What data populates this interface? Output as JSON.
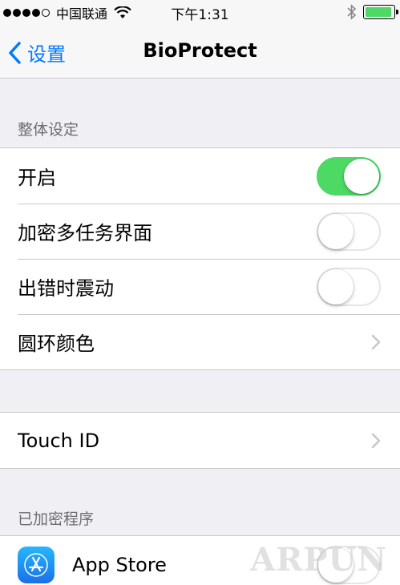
{
  "status_bar": {
    "carrier": "中国联通",
    "time": "下午1:31",
    "signal_bars_filled": 4,
    "signal_bars_total": 5,
    "battery_level": 0.95,
    "icons": [
      "wifi-icon",
      "bluetooth-icon",
      "battery-icon"
    ]
  },
  "nav": {
    "back_label": "设置",
    "title": "BioProtect"
  },
  "general": {
    "header": "整体设定",
    "rows": [
      {
        "label": "开启",
        "control": "toggle",
        "on": true
      },
      {
        "label": "加密多任务界面",
        "control": "toggle",
        "on": false
      },
      {
        "label": "出错时震动",
        "control": "toggle",
        "on": false
      },
      {
        "label": "圆环颜色",
        "control": "chevron"
      }
    ]
  },
  "touch_id": {
    "label": "Touch ID"
  },
  "encrypted_apps": {
    "header": "已加密程序",
    "rows": [
      {
        "label": "App Store",
        "icon": "app-store-icon",
        "on": false
      }
    ]
  },
  "watermark": "ARPUN",
  "colors": {
    "accent": "#007aff",
    "toggle_on": "#4cd964",
    "background": "#efeff4",
    "separator": "#c8c7cc"
  }
}
